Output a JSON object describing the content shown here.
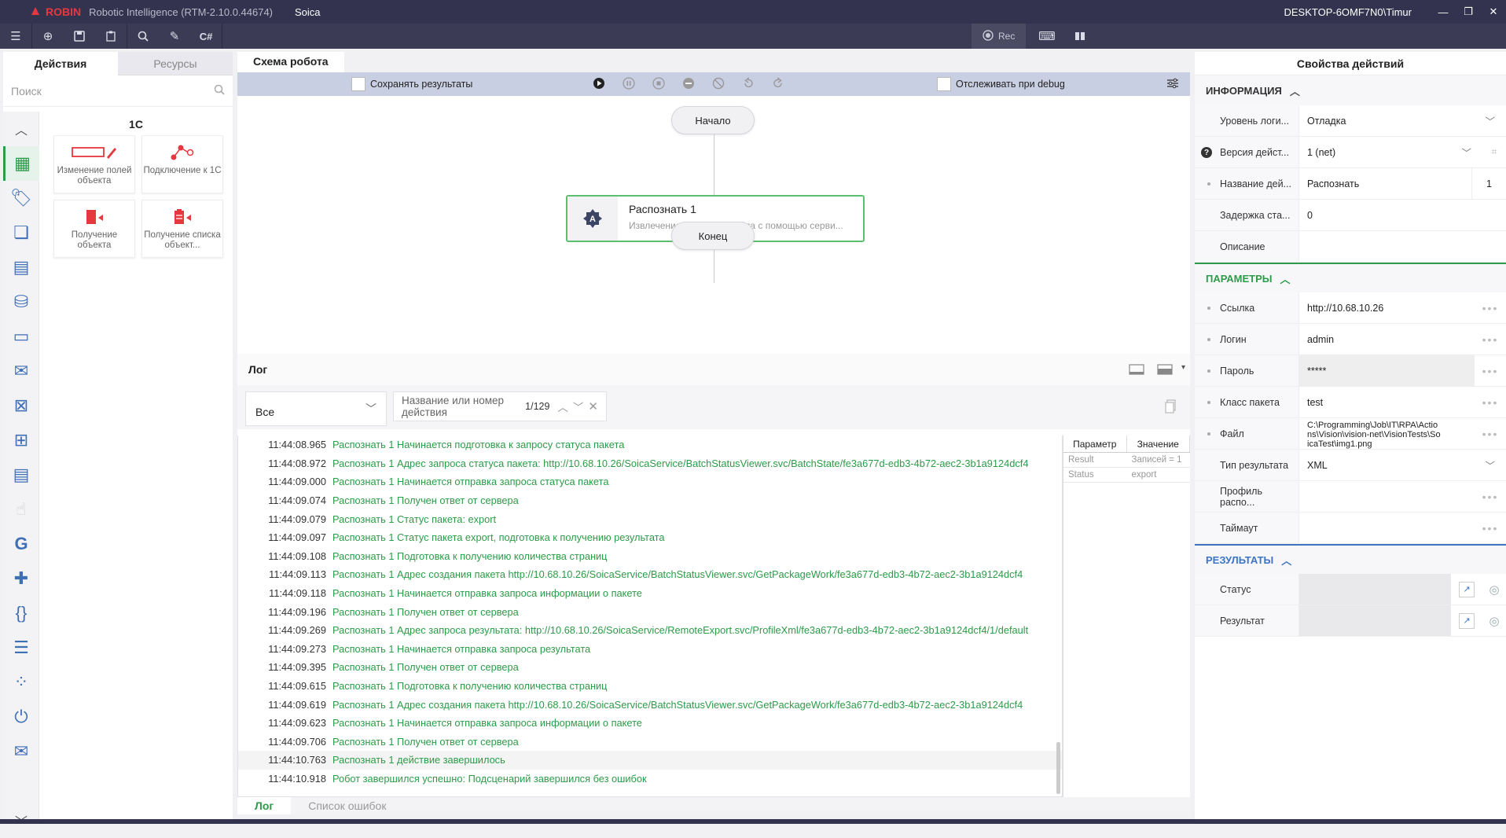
{
  "titlebar": {
    "logo": "ROBIN",
    "app_name": "Robotic Intelligence (RTM-2.10.0.44674)",
    "project": "Soica",
    "user": "DESKTOP-6OMF7N0\\Timur"
  },
  "toolbar": {
    "rec_label": "Rec"
  },
  "left_panel": {
    "tabs": [
      "Действия",
      "Ресурсы"
    ],
    "search_placeholder": "Поиск",
    "category_title": "1С",
    "tiles": [
      "Изменение полей объекта",
      "Подключение к 1С",
      "Получение объекта",
      "Получение списка объект..."
    ]
  },
  "scheme": {
    "tab_label": "Схема робота",
    "save_results_label": "Сохранять результаты",
    "track_debug_label": "Отслеживать при debug",
    "start_node": "Начало",
    "end_node": "Конец",
    "action_node_title": "Распознать  1",
    "action_node_desc": "Извлечение текста из файла с помощью серви..."
  },
  "log": {
    "title": "Лог",
    "filter_value": "Все",
    "search_placeholder": "Название или номер действия",
    "counter": "1/129",
    "lines": [
      {
        "time": "11:44:08.965",
        "msg": "Распознать 1 Начинается подготовка к запросу статуса пакета"
      },
      {
        "time": "11:44:08.972",
        "msg": "Распознать 1 Адрес запроса статуса пакета: http://10.68.10.26/SoicaService/BatchStatusViewer.svc/BatchState/fe3a677d-edb3-4b72-aec2-3b1a9124dcf4"
      },
      {
        "time": "11:44:09.000",
        "msg": "Распознать 1 Начинается отправка запроса статуса пакета"
      },
      {
        "time": "11:44:09.074",
        "msg": "Распознать 1 Получен ответ от сервера"
      },
      {
        "time": "11:44:09.079",
        "msg": "Распознать 1 Статус пакета: export"
      },
      {
        "time": "11:44:09.097",
        "msg": "Распознать 1 Статус пакета export, подготовка к получению результата"
      },
      {
        "time": "11:44:09.108",
        "msg": "Распознать 1 Подготовка к получению количества страниц"
      },
      {
        "time": "11:44:09.113",
        "msg": "Распознать 1 Адрес создания пакета http://10.68.10.26/SoicaService/BatchStatusViewer.svc/GetPackageWork/fe3a677d-edb3-4b72-aec2-3b1a9124dcf4"
      },
      {
        "time": "11:44:09.118",
        "msg": "Распознать 1 Начинается отправка запроса информации о пакете"
      },
      {
        "time": "11:44:09.196",
        "msg": "Распознать 1 Получен ответ от сервера"
      },
      {
        "time": "11:44:09.269",
        "msg": "Распознать 1 Адрес запроса результата: http://10.68.10.26/SoicaService/RemoteExport.svc/ProfileXml/fe3a677d-edb3-4b72-aec2-3b1a9124dcf4/1/default"
      },
      {
        "time": "11:44:09.273",
        "msg": "Распознать 1 Начинается отправка запроса результата"
      },
      {
        "time": "11:44:09.395",
        "msg": "Распознать 1 Получен ответ от сервера"
      },
      {
        "time": "11:44:09.615",
        "msg": "Распознать 1 Подготовка к получению количества страниц"
      },
      {
        "time": "11:44:09.619",
        "msg": "Распознать 1 Адрес создания пакета http://10.68.10.26/SoicaService/BatchStatusViewer.svc/GetPackageWork/fe3a677d-edb3-4b72-aec2-3b1a9124dcf4"
      },
      {
        "time": "11:44:09.623",
        "msg": "Распознать 1 Начинается отправка запроса информации о пакете"
      },
      {
        "time": "11:44:09.706",
        "msg": "Распознать 1 Получен ответ от сервера"
      },
      {
        "time": "11:44:10.763",
        "msg": "Распознать 1 действие завершилось"
      },
      {
        "time": "11:44:10.918",
        "msg": "Робот завершился успешно: Подсценарий завершился без ошибок"
      }
    ],
    "param_table": {
      "headers": [
        "Параметр",
        "Значение"
      ],
      "rows": [
        [
          "Result",
          "Записей = 1"
        ],
        [
          "Status",
          "export"
        ]
      ]
    },
    "bottom_tabs": [
      "Лог",
      "Список ошибок"
    ]
  },
  "right_panel": {
    "title": "Свойства действий",
    "info_section": "ИНФОРМАЦИЯ",
    "info_rows": [
      {
        "label": "Уровень логи...",
        "value": "Отладка"
      },
      {
        "label": "Версия дейст...",
        "value": "1 (net)"
      },
      {
        "label": "Название дей...",
        "value": "Распознать",
        "extra": "1"
      },
      {
        "label": "Задержка ста...",
        "value": "0"
      },
      {
        "label": "Описание",
        "value": ""
      }
    ],
    "params_section": "ПАРАМЕТРЫ",
    "param_rows": [
      {
        "label": "Ссылка",
        "value": "http://10.68.10.26"
      },
      {
        "label": "Логин",
        "value": "admin"
      },
      {
        "label": "Пароль",
        "value": "*****"
      },
      {
        "label": "Класс пакета",
        "value": "test"
      },
      {
        "label": "Файл",
        "value": "C:\\Programming\\Job\\IT\\RPA\\Actions\\Vision\\vision-net\\VisionTests\\SoicaTest\\img1.png"
      },
      {
        "label": "Тип результата",
        "value": "XML"
      },
      {
        "label": "Профиль распо...",
        "value": ""
      },
      {
        "label": "Таймаут",
        "value": ""
      }
    ],
    "results_section": "РЕЗУЛЬТАТЫ",
    "result_rows": [
      {
        "label": "Статус",
        "value": ""
      },
      {
        "label": "Результат",
        "value": ""
      }
    ]
  }
}
